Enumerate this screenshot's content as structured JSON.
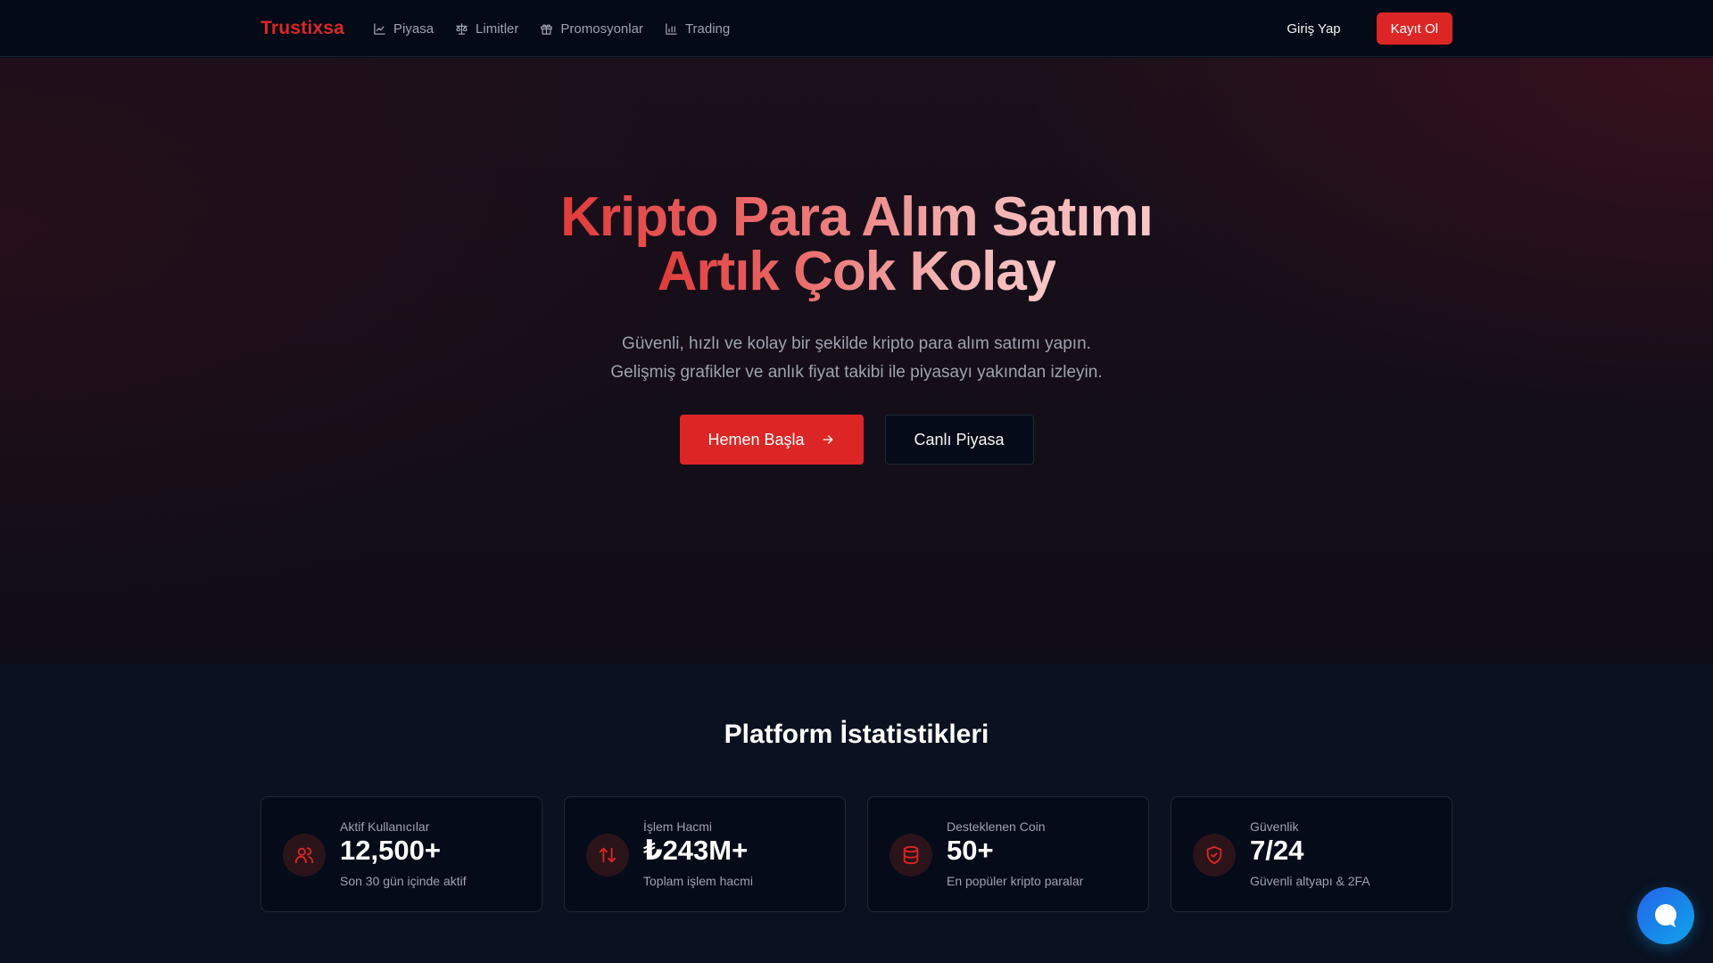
{
  "nav": {
    "brand": "Trustixsa",
    "links": [
      {
        "label": "Piyasa",
        "icon": "line-chart-icon"
      },
      {
        "label": "Limitler",
        "icon": "scale-icon"
      },
      {
        "label": "Promosyonlar",
        "icon": "gift-icon"
      },
      {
        "label": "Trading",
        "icon": "bar-chart-icon"
      }
    ],
    "login_label": "Giriş Yap",
    "register_label": "Kayıt Ol"
  },
  "hero": {
    "title_line1": "Kripto Para Alım Satımı",
    "title_line2": "Artık Çok Kolay",
    "subtitle_line1": "Güvenli, hızlı ve kolay bir şekilde kripto para alım satımı yapın.",
    "subtitle_line2": "Gelişmiş grafikler ve anlık fiyat takibi ile piyasayı yakından izleyin.",
    "primary_button": "Hemen Başla",
    "secondary_button": "Canlı Piyasa"
  },
  "stats": {
    "title": "Platform İstatistikleri",
    "cards": [
      {
        "label": "Aktif Kullanıcılar",
        "value": "12,500+",
        "desc": "Son 30 gün içinde aktif",
        "icon": "users-icon"
      },
      {
        "label": "İşlem Hacmi",
        "value": "₺243M+",
        "desc": "Toplam işlem hacmi",
        "icon": "arrows-up-down-icon"
      },
      {
        "label": "Desteklenen Coin",
        "value": "50+",
        "desc": "En popüler kripto paralar",
        "icon": "database-icon"
      },
      {
        "label": "Güvenlik",
        "value": "7/24",
        "desc": "Güvenli altyapı & 2FA",
        "icon": "shield-check-icon"
      }
    ]
  },
  "colors": {
    "accent": "#dc2626",
    "background": "#050b18",
    "chat_gradient_start": "#2563eb",
    "chat_gradient_end": "#0ea5e9"
  },
  "chat": {
    "icon": "chat-bubble-icon"
  }
}
